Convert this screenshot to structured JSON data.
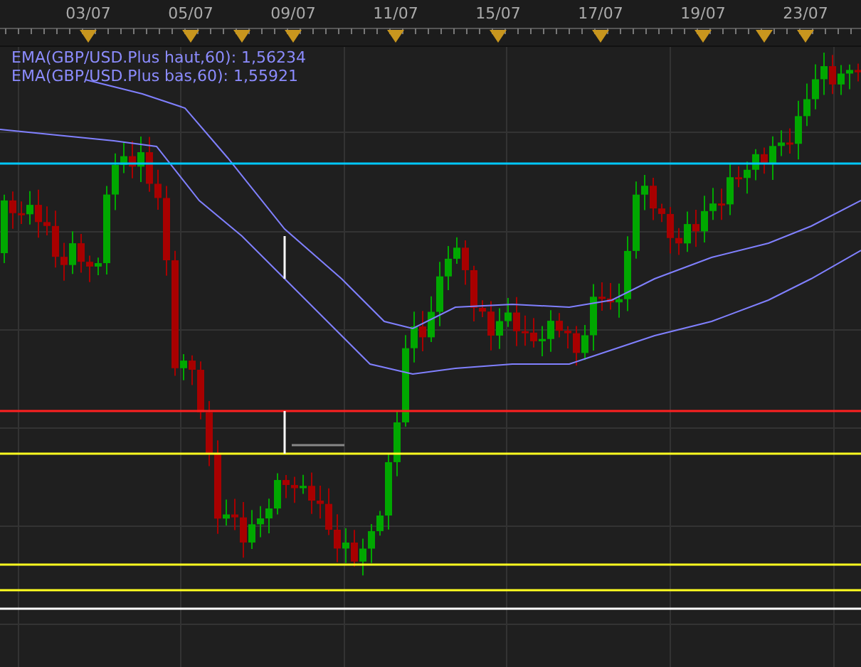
{
  "x_axis": {
    "labels": [
      "03/07",
      "05/07",
      "09/07",
      "11/07",
      "15/07",
      "17/07",
      "19/07",
      "23/07"
    ]
  },
  "legend": [
    {
      "text": "EMA(GBP/USD.Plus haut,60): 1,56234"
    },
    {
      "text": "EMA(GBP/USD.Plus bas,60): 1,55921"
    }
  ]
}
